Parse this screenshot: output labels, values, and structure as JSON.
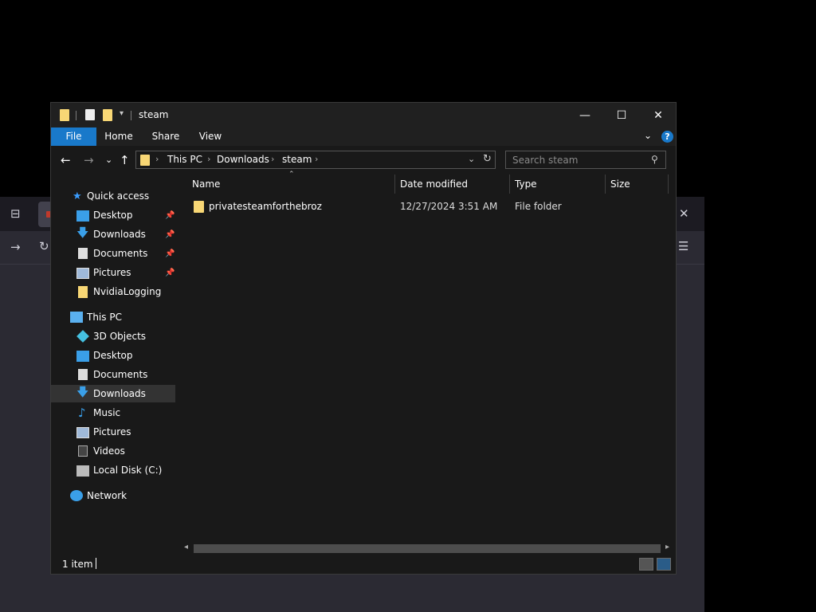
{
  "explorer": {
    "title": "steam",
    "window_controls": {
      "minimize": "—",
      "maximize": "☐",
      "close": "✕"
    },
    "ribbon": {
      "tabs": [
        "File",
        "Home",
        "Share",
        "View"
      ],
      "help": "?"
    },
    "address": {
      "crumbs": [
        "This PC",
        "Downloads",
        "steam"
      ],
      "search_placeholder": "Search steam"
    },
    "nav_pane": {
      "quick_access": {
        "label": "Quick access",
        "items": [
          "Desktop",
          "Downloads",
          "Documents",
          "Pictures",
          "NvidiaLogging"
        ]
      },
      "this_pc": {
        "label": "This PC",
        "items": [
          "3D Objects",
          "Desktop",
          "Documents",
          "Downloads",
          "Music",
          "Pictures",
          "Videos",
          "Local Disk (C:)"
        ]
      },
      "network": {
        "label": "Network"
      },
      "selected": "Downloads"
    },
    "columns": [
      "Name",
      "Date modified",
      "Type",
      "Size"
    ],
    "files": [
      {
        "name": "privatesteamforthebroz",
        "date_modified": "12/27/2024 3:51 AM",
        "type": "File folder",
        "size": ""
      }
    ],
    "status": "1 item"
  },
  "colors": {
    "accent": "#1979ca",
    "folder": "#f8d775",
    "background": "#191919"
  }
}
